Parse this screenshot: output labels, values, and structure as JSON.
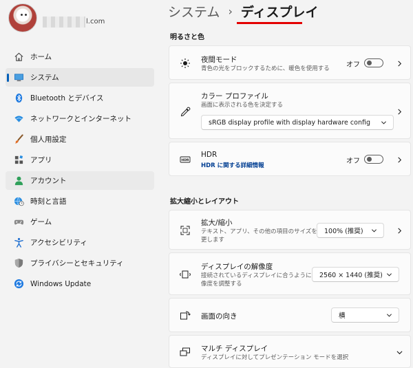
{
  "user": {
    "email_suffix": "l.com"
  },
  "sidebar": {
    "items": [
      {
        "label": "ホーム",
        "icon": "home-icon"
      },
      {
        "label": "システム",
        "icon": "monitor-icon"
      },
      {
        "label": "Bluetooth とデバイス",
        "icon": "bluetooth-icon"
      },
      {
        "label": "ネットワークとインターネット",
        "icon": "wifi-icon"
      },
      {
        "label": "個人用設定",
        "icon": "brush-icon"
      },
      {
        "label": "アプリ",
        "icon": "apps-icon"
      },
      {
        "label": "アカウント",
        "icon": "person-icon"
      },
      {
        "label": "時刻と言語",
        "icon": "globe-clock-icon"
      },
      {
        "label": "ゲーム",
        "icon": "gamepad-icon"
      },
      {
        "label": "アクセシビリティ",
        "icon": "accessibility-icon"
      },
      {
        "label": "プライバシーとセキュリティ",
        "icon": "shield-icon"
      },
      {
        "label": "Windows Update",
        "icon": "update-icon"
      }
    ]
  },
  "header": {
    "parent": "システム",
    "separator": "›",
    "current": "ディスプレイ"
  },
  "sections": {
    "brightness_color": "明るさと色",
    "scale_layout": "拡大縮小とレイアウト"
  },
  "night_light": {
    "title": "夜間モード",
    "desc": "青色の光をブロックするために、暖色を使用する",
    "state": "オフ"
  },
  "color_profile": {
    "title": "カラー プロファイル",
    "desc": "画面に表示される色を決定する",
    "selected": "sRGB display profile with display hardware config"
  },
  "hdr": {
    "title": "HDR",
    "link": "HDR に関する詳細情報",
    "state": "オフ"
  },
  "scale": {
    "title": "拡大/縮小",
    "desc_line1": "テキスト、アプリ、その他の項目のサイズを変",
    "desc_line2": "更します",
    "selected": "100% (推奨)"
  },
  "resolution": {
    "title": "ディスプレイの解像度",
    "desc_line1": "接続されているディスプレイに合うように解",
    "desc_line2": "像度を調整する",
    "selected": "2560 × 1440 (推奨)"
  },
  "orientation": {
    "title": "画面の向き",
    "selected": "横"
  },
  "multi_display": {
    "title": "マルチ ディスプレイ",
    "desc": "ディスプレイに対してプレゼンテーション モードを選択"
  },
  "colors": {
    "accent": "#005fb8",
    "underline": "#e30000"
  }
}
